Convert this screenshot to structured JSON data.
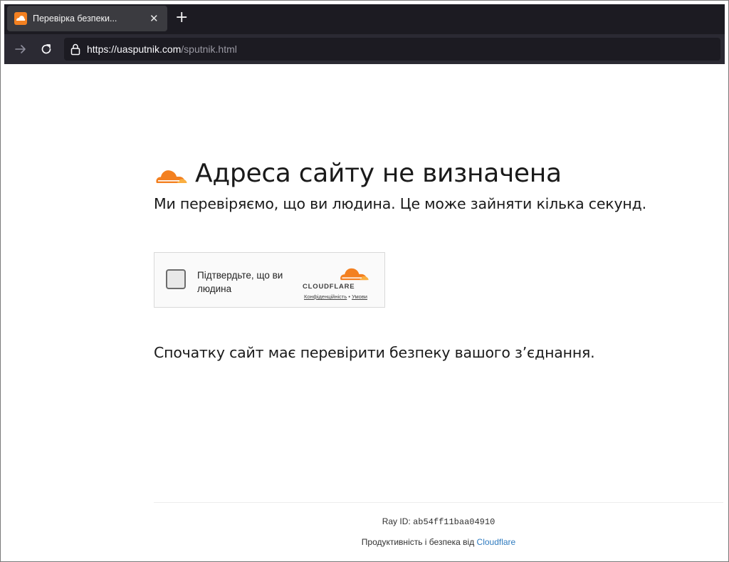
{
  "browser": {
    "tab_title": "Перевірка безпеки...",
    "tab_close": "✕",
    "new_tab": "+",
    "url_host": "https://uasputnik.com",
    "url_path": "/sputnik.html"
  },
  "colors": {
    "accent": "#f38020",
    "link": "#2f7bbf",
    "chrome_bg": "#2b2a33"
  },
  "page": {
    "heading": "Адреса сайту не визначена",
    "subtitle": "Ми перевіряємо, що ви людина. Це може зайняти кілька секунд.",
    "note": "Спочатку сайт має перевірити безпеку вашого з’єднання."
  },
  "widget": {
    "label": "Підтвердьте, що ви людина",
    "brand": "CLOUDFLARE",
    "privacy_link": "Конфіденційність",
    "separator": " • ",
    "terms_link": "Умови"
  },
  "footer": {
    "ray_label": "Ray ID: ",
    "ray_value": "ab54ff11baa04910",
    "perf_text": "Продуктивність і безпека від ",
    "perf_link": "Cloudflare"
  }
}
